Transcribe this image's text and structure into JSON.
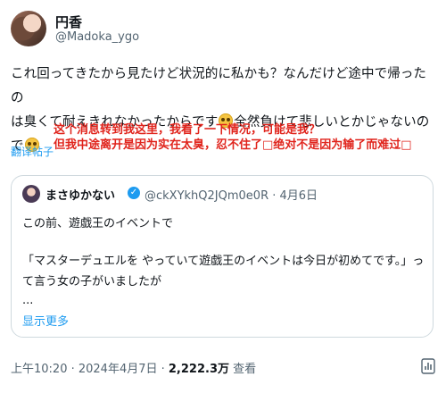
{
  "author": {
    "name": "円香",
    "handle": "@Madoka_ygo"
  },
  "post": {
    "line1": "これ回ってきたから見たけど状況的に私かも？なんだけど途中で帰ったの",
    "line2": "は臭くて耐えきれなかったからです",
    "line2b": "全然負けて悲しいとかじゃないの",
    "line3": "で",
    "emoji_icon": "pleading-face-emoji"
  },
  "overlay_text": {
    "line1": "这个消息转到我这里，我看了一下情况，可能是我？",
    "line2": "但我中途离开是因为实在太臭，忍不住了□绝对不是因为输了而难过□"
  },
  "translate_label": "翻译帖子",
  "quoted_post": {
    "name": "まさゆかない",
    "handle": "@ckXYkhQ2JQm0e0R",
    "date": "4月6日",
    "line1": "この前、遊戯王のイベントで",
    "line2": "「マスターデュエルを やっていて遊戯王のイベントは今日が初めてです。」っ",
    "line3": "て言う女の子がいましたが",
    "line4": "...",
    "show_more": "显示更多"
  },
  "footer": {
    "time_date": "上午10:20 · 2024年4月7日 · ",
    "views_count": "2,222.3万",
    "views_label": " 查看"
  },
  "colors": {
    "accent": "#1d9bf0",
    "overlay": "#e0241c",
    "muted": "#536471"
  }
}
